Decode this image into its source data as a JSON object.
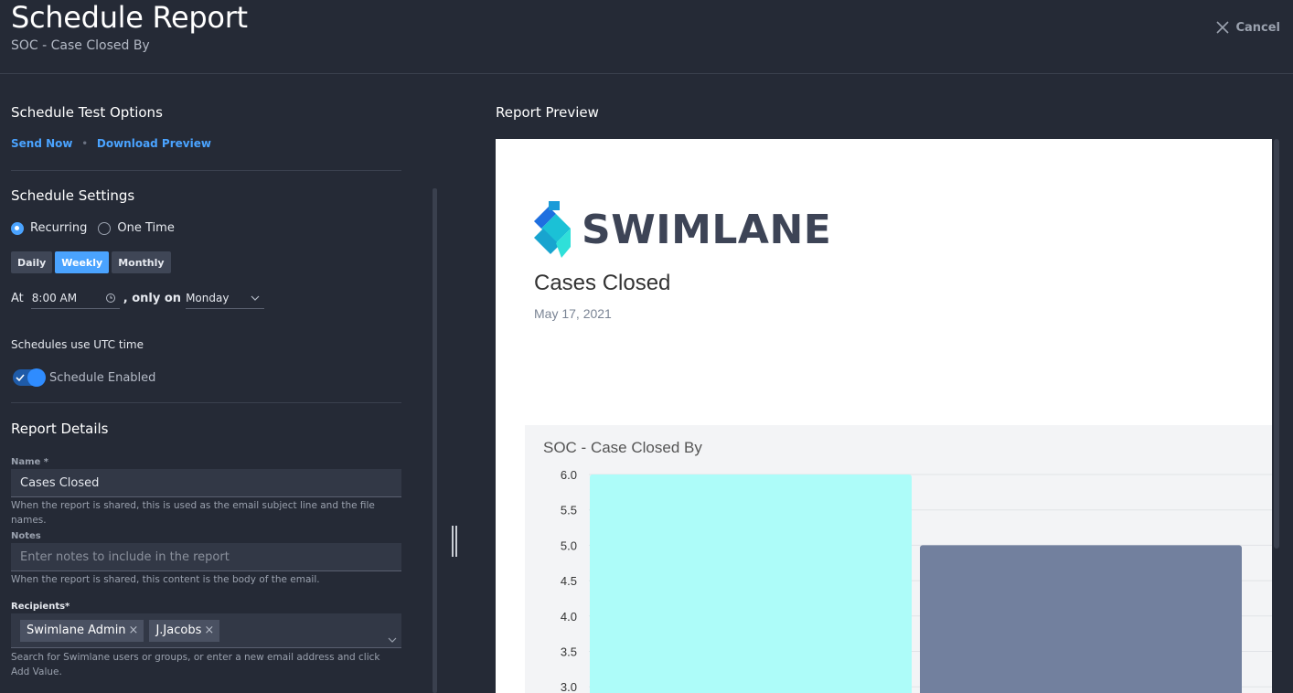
{
  "header": {
    "title": "Schedule Report",
    "subtitle": "SOC - Case Closed By",
    "cancel_label": "Cancel"
  },
  "test_options": {
    "title": "Schedule Test Options",
    "send_now": "Send Now",
    "separator": "•",
    "download_preview": "Download Preview"
  },
  "schedule": {
    "title": "Schedule Settings",
    "recurring": "Recurring",
    "one_time": "One Time",
    "selected_type": "Recurring",
    "frequencies": [
      "Daily",
      "Weekly",
      "Monthly"
    ],
    "active_frequency": "Weekly",
    "at_label": "At",
    "time_value": "8:00 AM",
    "only_on_label": ", only on",
    "day_value": "Monday",
    "utc_note": "Schedules use UTC time",
    "enabled_label": "Schedule Enabled",
    "enabled": true
  },
  "details": {
    "title": "Report Details",
    "name_label": "Name *",
    "name_value": "Cases Closed",
    "name_help": "When the report is shared, this is used as the email subject line and the file names.",
    "notes_label": "Notes",
    "notes_placeholder": "Enter notes to include in the report",
    "notes_help": "When the report is shared, this content is the body of the email.",
    "recipients_label": "Recipients*",
    "recipients": [
      "Swimlane Admin",
      "J.Jacobs"
    ],
    "remove_glyph": "×",
    "recipients_help": "Search for Swimlane users or groups, or enter a new email address and click Add Value."
  },
  "preview": {
    "title": "Report Preview",
    "logo_text": "SWIMLANE",
    "report_title": "Cases Closed",
    "report_date": "May 17, 2021"
  },
  "colors": {
    "accent": "#4aa3ff",
    "bar_1": "#adfcf9",
    "bar_2": "#72809e"
  },
  "chart_data": {
    "type": "bar",
    "title": "SOC - Case Closed By",
    "values": [
      6.0,
      5.0
    ],
    "yticks": [
      "6.0",
      "5.5",
      "5.0",
      "4.5",
      "4.0",
      "3.5",
      "3.0"
    ],
    "ylim_visible": [
      3.0,
      6.0
    ],
    "grid": true
  }
}
